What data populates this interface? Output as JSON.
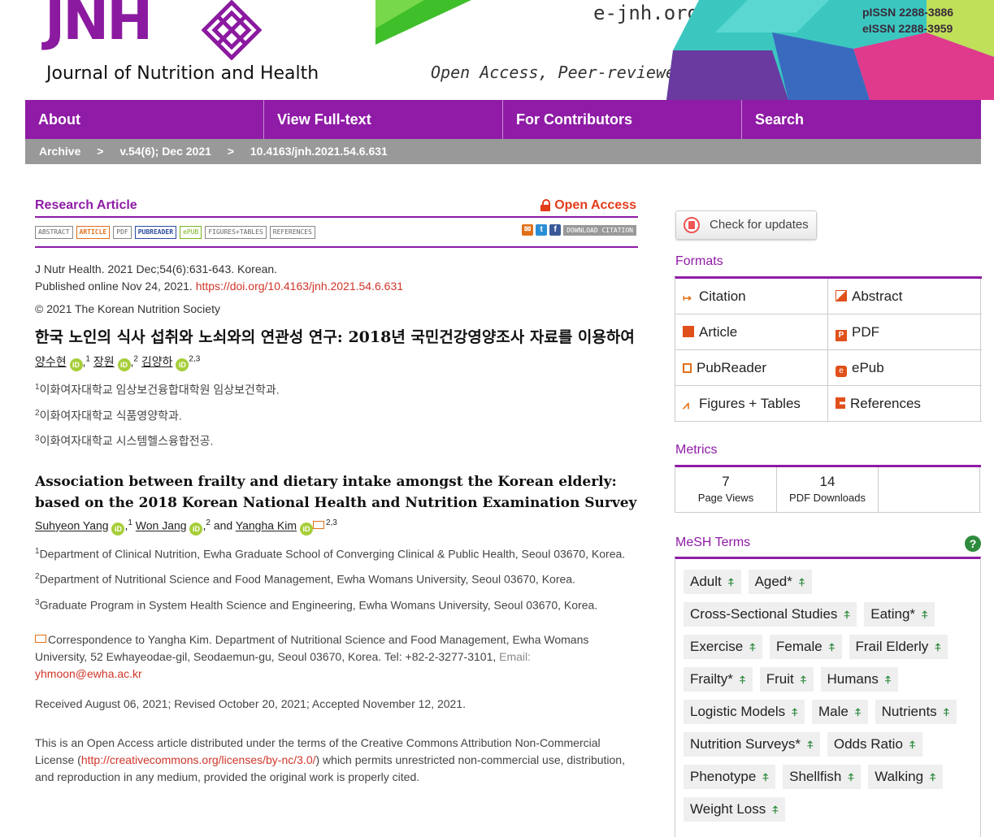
{
  "header": {
    "logo_text": "JNH",
    "journal_name": "Journal of Nutrition and Health",
    "site_url": "e-jnh.org",
    "tagline": "Open Access, Peer-reviewed",
    "pissn": "pISSN 2288-3886",
    "eissn": "eISSN 2288-3959"
  },
  "nav": {
    "items": [
      "About",
      "View Full-text",
      "For Contributors",
      "Search"
    ]
  },
  "breadcrumb": {
    "archive": "Archive",
    "issue": "v.54(6); Dec 2021",
    "doi": "10.4163/jnh.2021.54.6.631",
    "sep": ">"
  },
  "article": {
    "type": "Research Article",
    "open_access": "Open Access",
    "tabs": [
      "ABSTRACT",
      "ARTICLE",
      "PDF",
      "PUBREADER",
      "ePUB",
      "FIGURES+TABLES",
      "REFERENCES"
    ],
    "download_citation": "DOWNLOAD CITATION",
    "citation_line": "J Nutr Health. 2021 Dec;54(6):631-643. Korean.",
    "published": "Published online Nov 24, 2021.",
    "doi_url": "https://doi.org/10.4163/jnh.2021.54.6.631",
    "copyright": "© 2021 The Korean Nutrition Society",
    "title_ko": "한국 노인의 식사 섭취와 노쇠와의 연관성 연구: 2018년 국민건강영양조사 자료를 이용하여",
    "authors_ko": [
      {
        "name": "양수현",
        "sup": "1"
      },
      {
        "name": "장원",
        "sup": "2"
      },
      {
        "name": "김양하",
        "sup": "2,3"
      }
    ],
    "affiliations_ko": [
      {
        "sup": "1",
        "text": "이화여자대학교 임상보건융합대학원 임상보건학과."
      },
      {
        "sup": "2",
        "text": "이화여자대학교 식품영양학과."
      },
      {
        "sup": "3",
        "text": "이화여자대학교 시스템헬스융합전공."
      }
    ],
    "title_en": "Association between frailty and dietary intake amongst the Korean elderly: based on the 2018 Korean National Health and Nutrition Examination Survey",
    "authors_en": [
      {
        "name": "Suhyeon Yang",
        "sup": "1"
      },
      {
        "name": "Won Jang",
        "sup": "2"
      },
      {
        "name": "Yangha Kim",
        "sup": "2,3"
      }
    ],
    "and_word": "and",
    "affiliations_en": [
      {
        "sup": "1",
        "text": "Department of Clinical Nutrition, Ewha Graduate School of Converging Clinical & Public Health, Seoul 03670, Korea."
      },
      {
        "sup": "2",
        "text": "Department of Nutritional Science and Food Management, Ewha Womans University, Seoul 03670, Korea."
      },
      {
        "sup": "3",
        "text": "Graduate Program in System Health Science and Engineering, Ewha Womans University, Seoul 03670, Korea."
      }
    ],
    "correspondence": "Correspondence to Yangha Kim. Department of Nutritional Science and Food Management, Ewha Womans University, 52 Ewhayeodae-gil, Seodaemun-gu, Seoul 03670, Korea. Tel: +82-2-3277-3101,",
    "email_label": "Email:",
    "email": "yhmoon@ewha.ac.kr",
    "dates": "Received August 06, 2021; Revised October 20, 2021; Accepted November 12, 2021.",
    "license_pre": "This is an Open Access article distributed under the terms of the Creative Commons Attribution Non-Commercial License (",
    "license_url": "http://creativecommons.org/licenses/by-nc/3.0/",
    "license_post": ") which permits unrestricted non-commercial use, distribution, and reproduction in any medium, provided the original work is properly cited."
  },
  "sidebar": {
    "check_updates": "Check for updates",
    "formats_title": "Formats",
    "formats": [
      {
        "label": "Citation",
        "icon": "citation-icon"
      },
      {
        "label": "Abstract",
        "icon": "abstract-icon"
      },
      {
        "label": "Article",
        "icon": "article-icon"
      },
      {
        "label": "PDF",
        "icon": "pdf-icon"
      },
      {
        "label": "PubReader",
        "icon": "pubreader-icon"
      },
      {
        "label": "ePub",
        "icon": "epub-icon"
      },
      {
        "label": "Figures + Tables",
        "icon": "figures-icon"
      },
      {
        "label": "References",
        "icon": "references-icon"
      }
    ],
    "metrics_title": "Metrics",
    "metrics": [
      {
        "value": "7",
        "label": "Page Views"
      },
      {
        "value": "14",
        "label": "PDF Downloads"
      }
    ],
    "mesh_title": "MeSH Terms",
    "mesh_terms": [
      "Adult",
      "Aged*",
      "Cross-Sectional Studies",
      "Eating*",
      "Exercise",
      "Female",
      "Frail Elderly",
      "Frailty*",
      "Fruit",
      "Humans",
      "Logistic Models",
      "Male",
      "Nutrients",
      "Nutrition Surveys*",
      "Odds Ratio",
      "Phenotype",
      "Shellfish",
      "Walking",
      "Weight Loss"
    ]
  },
  "colors": {
    "brand_purple": "#8f1ba6",
    "link_red": "#d0362a",
    "orcid_green": "#a6ce39",
    "pin_green": "#2e8b3e"
  }
}
